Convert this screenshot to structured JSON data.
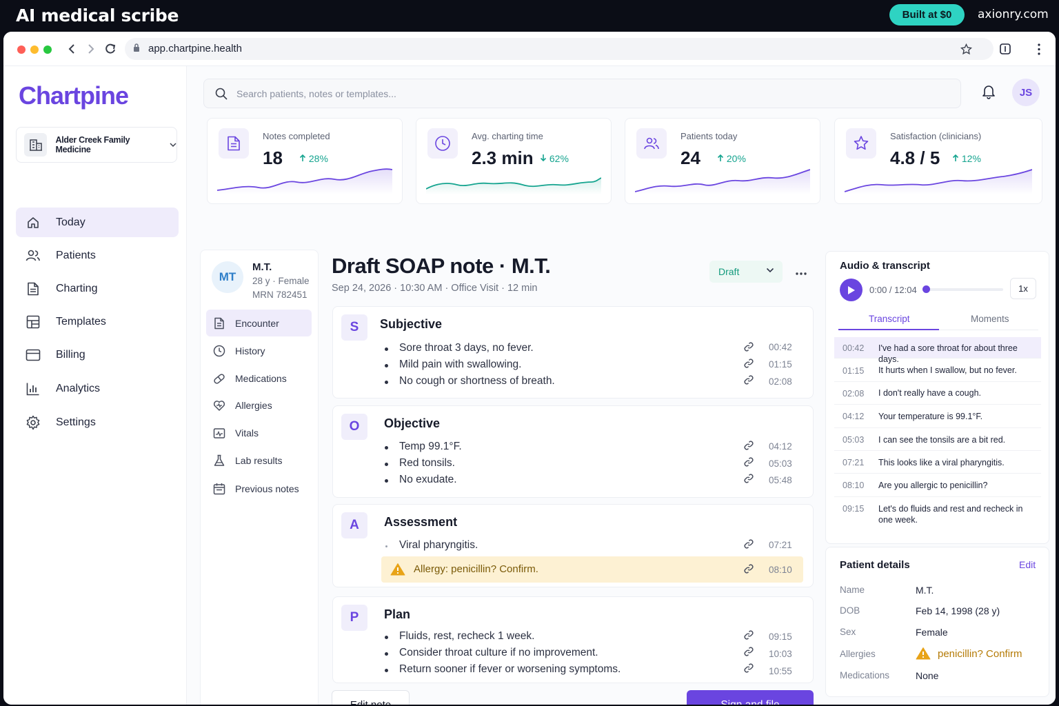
{
  "banner": {
    "title": "AI medical scribe",
    "badge": "Built at $0",
    "domain": "axionry.com"
  },
  "browser": {
    "url": "app.chartpine.health"
  },
  "sidebar": {
    "logo": "Chartpine",
    "clinic": "Alder Creek Family Medicine",
    "items": [
      {
        "label": "Today",
        "icon": "home-icon",
        "active": true
      },
      {
        "label": "Patients",
        "icon": "users-icon"
      },
      {
        "label": "Charting",
        "icon": "document-icon"
      },
      {
        "label": "Templates",
        "icon": "grid-icon"
      },
      {
        "label": "Billing",
        "icon": "card-icon"
      },
      {
        "label": "Analytics",
        "icon": "bar-chart-icon"
      },
      {
        "label": "Settings",
        "icon": "gear-icon"
      }
    ]
  },
  "header": {
    "search_placeholder": "Search patients, notes or templates...",
    "avatar": "JS"
  },
  "stats": [
    {
      "label": "Notes completed",
      "value": "18",
      "change": "28%",
      "direction": "up",
      "icon": "document-icon",
      "color": "#6a45e0"
    },
    {
      "label": "Avg. charting time",
      "value": "2.3 min",
      "change": "62%",
      "direction": "down",
      "icon": "clock-icon",
      "color": "#15a48f"
    },
    {
      "label": "Patients today",
      "value": "24",
      "change": "20%",
      "direction": "up",
      "icon": "users-icon",
      "color": "#6a45e0"
    },
    {
      "label": "Satisfaction (clinicians)",
      "value": "4.8 / 5",
      "change": "12%",
      "direction": "up",
      "icon": "star-icon",
      "color": "#6a45e0"
    }
  ],
  "patient": {
    "initials": "MT",
    "name": "M.T.",
    "info": "28 y · Female",
    "mrn": "MRN 782451",
    "nav": [
      {
        "label": "Encounter",
        "icon": "document-icon",
        "active": true
      },
      {
        "label": "History",
        "icon": "clock-icon"
      },
      {
        "label": "Medications",
        "icon": "pill-icon"
      },
      {
        "label": "Allergies",
        "icon": "heart-icon"
      },
      {
        "label": "Vitals",
        "icon": "vitals-icon"
      },
      {
        "label": "Lab results",
        "icon": "flask-icon"
      },
      {
        "label": "Previous notes",
        "icon": "calendar-icon"
      }
    ]
  },
  "note": {
    "title": "Draft SOAP note · M.T.",
    "meta": "Sep 24, 2026 · 10:30 AM · Office Visit · 12 min",
    "status": "Draft",
    "sections": [
      {
        "letter": "S",
        "title": "Subjective",
        "items": [
          {
            "text": "Sore throat 3 days, no fever.",
            "time": "00:42"
          },
          {
            "text": "Mild pain with swallowing.",
            "time": "01:15"
          },
          {
            "text": "No cough or shortness of breath.",
            "time": "02:08"
          }
        ]
      },
      {
        "letter": "O",
        "title": "Objective",
        "items": [
          {
            "text": "Temp 99.1°F.",
            "time": "04:12"
          },
          {
            "text": "Red tonsils.",
            "time": "05:03"
          },
          {
            "text": "No exudate.",
            "time": "05:48"
          }
        ]
      },
      {
        "letter": "A",
        "title": "Assessment",
        "items": [
          {
            "text": "Viral pharyngitis.",
            "time": "07:21"
          }
        ],
        "alert": {
          "text": "Allergy: penicillin? Confirm.",
          "time": "08:10"
        }
      },
      {
        "letter": "P",
        "title": "Plan",
        "items": [
          {
            "text": "Fluids, rest, recheck 1 week.",
            "time": "09:15"
          },
          {
            "text": "Consider throat culture if no improvement.",
            "time": "10:03"
          },
          {
            "text": "Return sooner if fever or worsening symptoms.",
            "time": "10:55"
          }
        ]
      }
    ],
    "edit_label": "Edit note",
    "sign_label": "Sign and file"
  },
  "audio": {
    "title": "Audio & transcript",
    "time": "0:00 / 12:04",
    "speed": "1x",
    "tabs": [
      "Transcript",
      "Moments"
    ],
    "transcript": [
      {
        "time": "00:42",
        "text": "I've had a sore throat for about three days."
      },
      {
        "time": "01:15",
        "text": "It hurts when I swallow, but no fever."
      },
      {
        "time": "02:08",
        "text": "I don't really have a cough."
      },
      {
        "time": "04:12",
        "text": "Your temperature is 99.1°F."
      },
      {
        "time": "05:03",
        "text": "I can see the tonsils are a bit red."
      },
      {
        "time": "07:21",
        "text": "This looks like a viral pharyngitis."
      },
      {
        "time": "08:10",
        "text": "Are you allergic to penicillin?"
      },
      {
        "time": "09:15",
        "text": "Let's do fluids and rest and recheck in one week."
      }
    ]
  },
  "details": {
    "title": "Patient details",
    "edit": "Edit",
    "rows": [
      {
        "key": "Name",
        "value": "M.T."
      },
      {
        "key": "DOB",
        "value": "Feb 14, 1998 (28 y)"
      },
      {
        "key": "Sex",
        "value": "Female"
      },
      {
        "key": "Allergies",
        "value": "penicillin? Confirm"
      },
      {
        "key": "Medications",
        "value": "None"
      }
    ]
  }
}
